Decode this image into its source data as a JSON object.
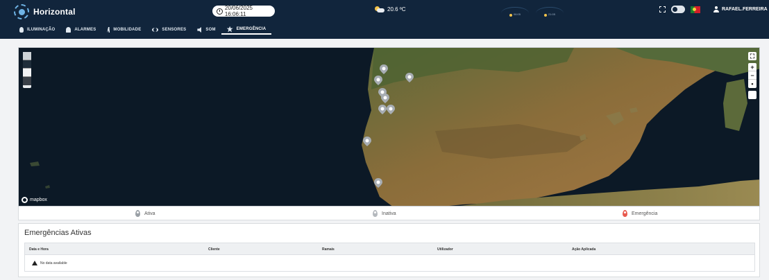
{
  "app": {
    "title": "Horizontal"
  },
  "header": {
    "datetime": "20/06/2025 16:06:11",
    "temperature": "20.6 ºC",
    "sunrise_time": "06:05",
    "sunset_time": "21:05",
    "user_name": "RAFAEL.FERREIRA"
  },
  "nav": {
    "items": [
      {
        "label": "ILUMINAÇÃO",
        "icon": "bulb-icon"
      },
      {
        "label": "ALARMES",
        "icon": "bell-icon"
      },
      {
        "label": "MOBILIDADE",
        "icon": "walk-icon"
      },
      {
        "label": "SENSORES",
        "icon": "sensor-icon"
      },
      {
        "label": "SOM",
        "icon": "sound-icon"
      },
      {
        "label": "EMERGÊNCIA",
        "icon": "emergency-icon",
        "active": true
      }
    ]
  },
  "map": {
    "attribution": "mapbox",
    "zoom_in": "+",
    "zoom_out": "−",
    "reset": "•"
  },
  "legend": {
    "active": "Ativa",
    "inactive": "Inativa",
    "emergency": "Emergência",
    "colors": {
      "active": "#9aa0a6",
      "inactive": "#b5b9be",
      "emergency": "#e85a4f"
    }
  },
  "emergencies": {
    "title": "Emergências Ativas",
    "columns": [
      "Data e Hora",
      "Cliente",
      "Ramais",
      "Utilizador",
      "Ação Aplicada"
    ],
    "empty_text": "No data available"
  }
}
